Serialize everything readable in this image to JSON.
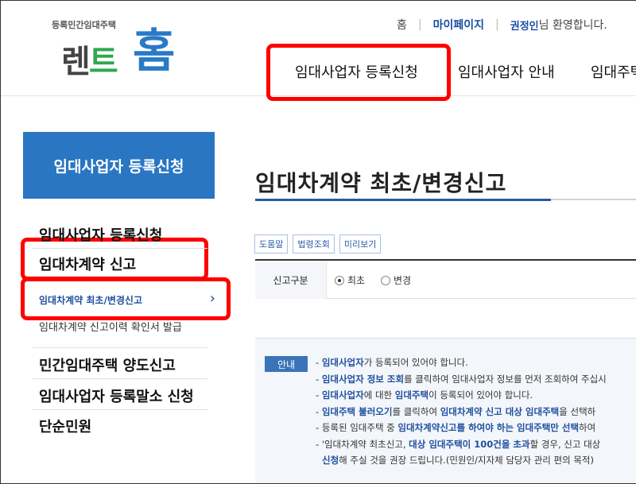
{
  "header": {
    "logo": {
      "sub": "등록민간임대주택",
      "rent": "렌트",
      "home": "홈"
    },
    "util": {
      "home": "홈",
      "mypage": "마이페이지",
      "user": "권정인",
      "welcome": "님 환영합니다."
    },
    "gnb": [
      "임대사업자 등록신청",
      "임대사업자 안내",
      "임대주택"
    ]
  },
  "sidebar": {
    "title": "임대사업자 등록신청",
    "items": [
      {
        "label": "임대사업자 등록신청"
      },
      {
        "label": "임대차계약 신고"
      },
      {
        "label": "임대차계약 최초/변경신고",
        "active": true,
        "chevron": "›"
      },
      {
        "label": "임대차계약 신고이력 확인서 발급"
      },
      {
        "label": "민간임대주택 양도신고"
      },
      {
        "label": "임대사업자 등록말소 신청"
      },
      {
        "label": "단순민원"
      }
    ]
  },
  "main": {
    "title": "임대차계약 최초/변경신고",
    "tools": [
      "도움말",
      "법령조회",
      "미리보기"
    ],
    "form": {
      "label": "신고구분",
      "options": [
        {
          "label": "최초",
          "checked": true
        },
        {
          "label": "변경",
          "checked": false
        }
      ]
    },
    "guide": {
      "badge": "안내",
      "lines": [
        {
          "pre": "- ",
          "b1": "임대사업자",
          "t1": "가 등록되어 있어야 합니다."
        },
        {
          "pre": "- ",
          "b1": "임대사업자 정보 조회",
          "t1": "를 클릭하여 임대사업자 정보를 먼저 조회하여 주십시"
        },
        {
          "pre": "- ",
          "b1": "임대사업자",
          "t1": "에 대한 ",
          "b2": "임대주택",
          "t2": "이 등록되어 있어야 합니다."
        },
        {
          "pre": "- ",
          "b1": "임대주택 불러오기",
          "t1": "를 클릭하여 ",
          "b2": "임대차계약 신고 대상 임대주택",
          "t2": "을 선택하"
        },
        {
          "pre": "- ",
          "t0": "등록된 임대주택 중 ",
          "b1": "임대차계약신고를 하여야 하는 임대주택만 선택",
          "t1": "하여"
        },
        {
          "pre": "- ",
          "t0": "'임대차계약 최초신고, ",
          "b1": "대상 임대주택이 100건을 초과",
          "t1": "할 경우, 신고 대상"
        },
        {
          "pre": "",
          "b1": "신청",
          "t1": "해 주실 것을 권장 드립니다.(민원인/지자체 담당자 관리 편의 목적)"
        }
      ]
    }
  },
  "colors": {
    "accent": "#2a76c2",
    "highlight": "#ff0000",
    "link": "#1f4f9e"
  }
}
